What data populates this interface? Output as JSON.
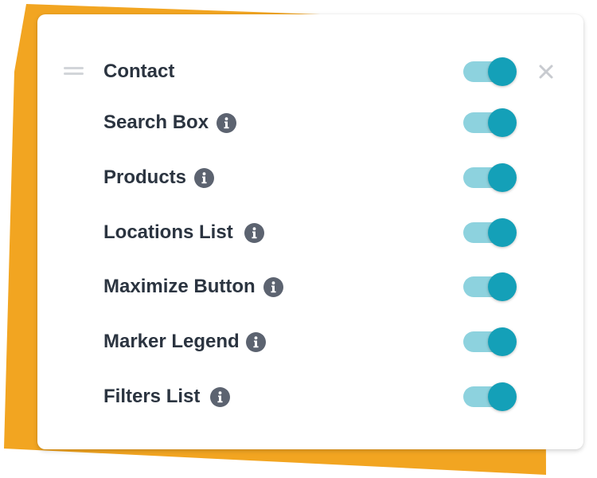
{
  "colors": {
    "accent_backdrop": "#f2a521",
    "toggle_track": "#8dd2de",
    "toggle_knob": "#14a0b8",
    "label_text": "#2b3440",
    "info_icon": "#5c6370",
    "close_icon": "#c8cbd0"
  },
  "panel": {
    "header": {
      "label": "Contact",
      "toggle_on": true,
      "drag_icon": "drag-handle-icon",
      "close_icon": "close-icon"
    },
    "items": [
      {
        "label": "Search Box",
        "info_icon": "info-icon",
        "toggle_on": true
      },
      {
        "label": "Products",
        "info_icon": "info-icon",
        "toggle_on": true
      },
      {
        "label": "Locations List",
        "info_icon": "info-icon",
        "toggle_on": true
      },
      {
        "label": "Maximize Button",
        "info_icon": "info-icon",
        "toggle_on": true
      },
      {
        "label": "Marker Legend",
        "info_icon": "info-icon",
        "toggle_on": true
      },
      {
        "label": "Filters List",
        "info_icon": "info-icon",
        "toggle_on": true
      }
    ]
  }
}
